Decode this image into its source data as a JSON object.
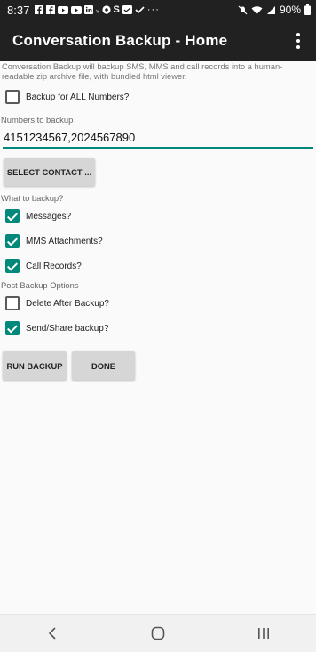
{
  "status_bar": {
    "time": "8:37",
    "battery": "90%",
    "left_icons": [
      "facebook-icon",
      "facebook-icon",
      "youtube-icon",
      "youtube-icon",
      "linkedin-icon",
      "vine-icon",
      "chrome-icon",
      "s-icon",
      "done-all-icon",
      "checkmark-icon",
      "more-icon"
    ],
    "right_icons": [
      "mute-icon",
      "wifi-icon",
      "signal-icon",
      "battery-icon"
    ]
  },
  "app_bar": {
    "title": "Conversation Backup - Home",
    "overflow_icon": "more-vert-icon"
  },
  "description": "Conversation Backup will backup SMS, MMS and call records into a human-readable zip archive file, with bundled html viewer.",
  "backup_all": {
    "label": "Backup for ALL Numbers?",
    "checked": false
  },
  "numbers_section": {
    "label": "Numbers to backup",
    "value": "4151234567,2024567890",
    "select_contact_label": "SELECT CONTACT ..."
  },
  "what_section": {
    "label": "What to backup?",
    "options": [
      {
        "label": "Messages?",
        "checked": true
      },
      {
        "label": "MMS Attachments?",
        "checked": true
      },
      {
        "label": "Call Records?",
        "checked": true
      }
    ]
  },
  "post_section": {
    "label": "Post Backup Options",
    "options": [
      {
        "label": "Delete After Backup?",
        "checked": false
      },
      {
        "label": "Send/Share backup?",
        "checked": true
      }
    ]
  },
  "actions": {
    "run_label": "RUN BACKUP",
    "done_label": "DONE"
  },
  "nav_bar": {
    "back_icon": "back-icon",
    "home_icon": "home-icon",
    "recents_icon": "recents-icon"
  },
  "colors": {
    "accent": "#00897b",
    "app_bar": "#212121",
    "button": "#d6d6d6"
  }
}
